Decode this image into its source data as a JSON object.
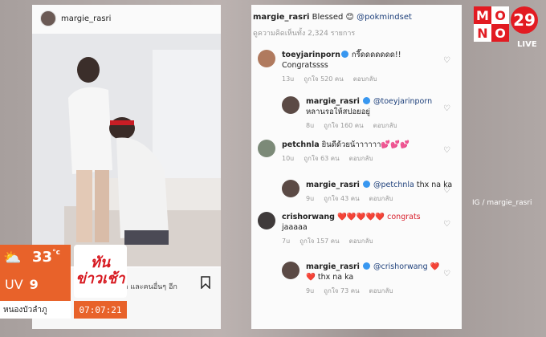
{
  "left_post": {
    "username": "margie_rasri",
    "likes_text": "yiada และคนอื่นๆ อีก"
  },
  "right_post": {
    "caption_user": "margie_rasri",
    "caption_text": " Blessed 😊 ",
    "caption_mention": "@pokmindset",
    "view_all": "ดูความคิดเห็นทั้ง 2,324 รายการ",
    "comments": [
      {
        "user": "toeyjarinporn",
        "text": " กรี๊ดดดดดดด!!",
        "text2": "Congratssss",
        "time": "13u",
        "likes": "ถูกใจ 520 คน",
        "reply": "ตอบกลับ"
      },
      {
        "user": "margie_rasri",
        "mention": "@toeyjarinporn",
        "text2": "หลานรอให้สปอยอยู่",
        "time": "8u",
        "likes": "ถูกใจ 160 คน",
        "reply": "ตอบกลับ"
      },
      {
        "user": "petchnla",
        "text": " ยินดีด้วยน้าาาาาา💕💕💕",
        "time": "10u",
        "likes": "ถูกใจ 63 คน",
        "reply": "ตอบกลับ"
      },
      {
        "user": "margie_rasri",
        "mention": "@petchnla",
        "text": " thx na ka",
        "time": "9u",
        "likes": "ถูกใจ 43 คน",
        "reply": "ตอบกลับ"
      },
      {
        "user": "crishorwang",
        "text": " ❤️❤️❤️❤️❤️ congrats",
        "text2": "jaaaaa",
        "time": "7u",
        "likes": "ถูกใจ 157 คน",
        "reply": "ตอบกลับ"
      },
      {
        "user": "margie_rasri",
        "mention": "@crishorwang",
        "text": " ❤️",
        "text2": "❤️ thx na ka",
        "time": "9u",
        "likes": "ถูกใจ 73 คน",
        "reply": "ตอบกลับ"
      }
    ]
  },
  "credit": "IG / margie_rasri",
  "channel": {
    "c1": "M",
    "c2": "O",
    "c3": "N",
    "c4": "O",
    "num": "29",
    "live": "LIVE"
  },
  "weather": {
    "temp": "33",
    "unit": "°c",
    "uv_label": "UV",
    "uv_value": "9"
  },
  "location": "หนองบัวลำภู",
  "show_logo": {
    "line1": "ทัน",
    "line2": "ข่าวเช้า"
  },
  "clock": "07:07:21"
}
